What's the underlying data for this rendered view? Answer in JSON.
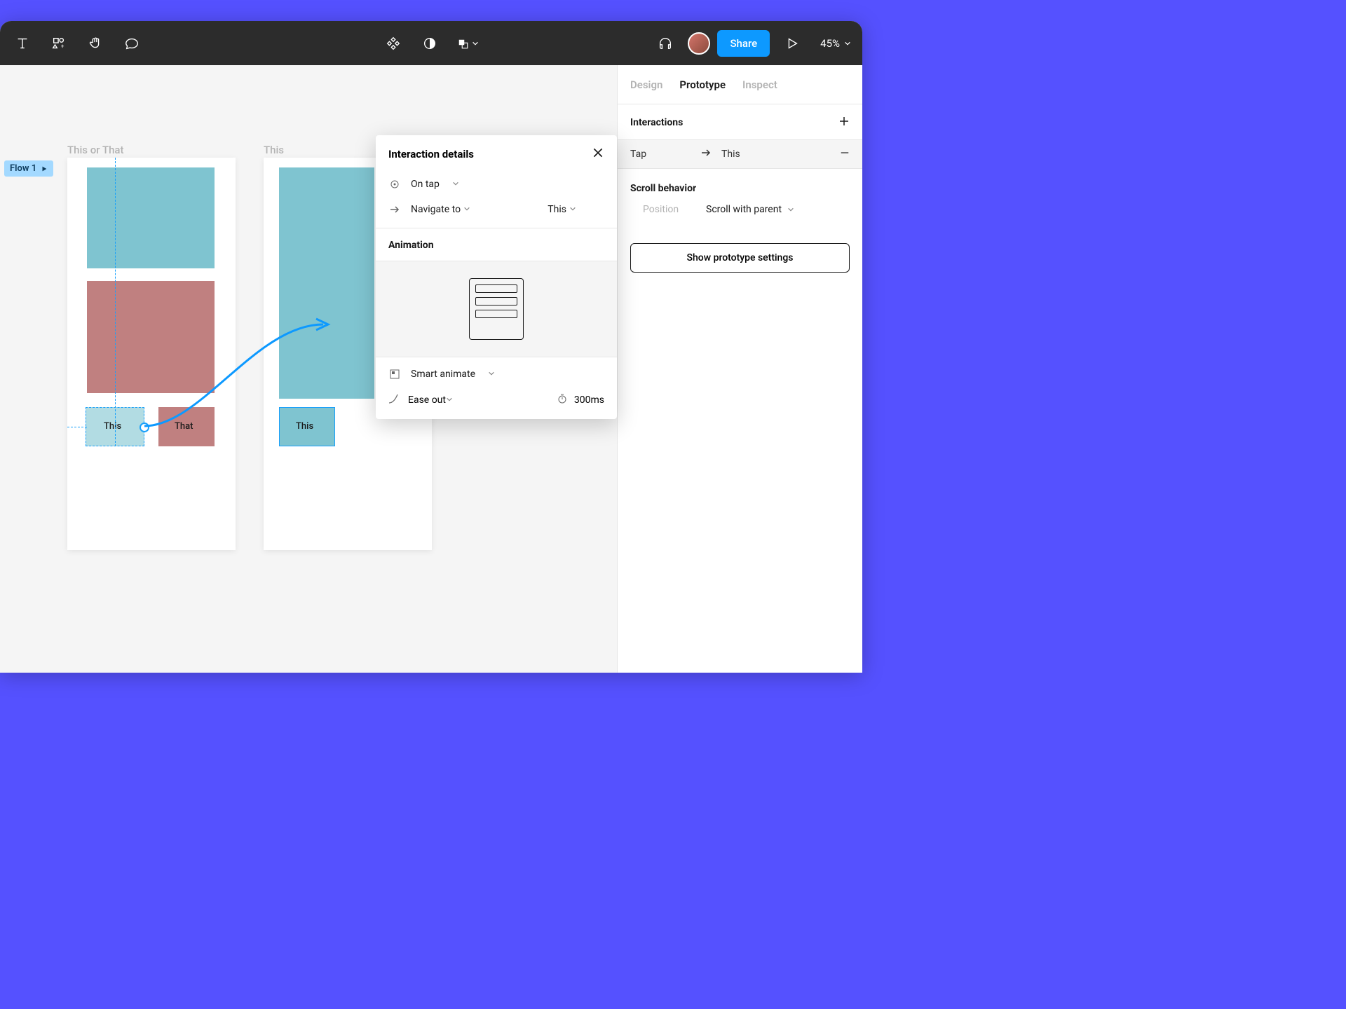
{
  "toolbar": {
    "share_label": "Share",
    "zoom": "45%"
  },
  "panel": {
    "tabs": {
      "design": "Design",
      "prototype": "Prototype",
      "inspect": "Inspect"
    },
    "interactions_title": "Interactions",
    "interaction": {
      "trigger": "Tap",
      "target": "This"
    },
    "scroll_title": "Scroll behavior",
    "scroll_position_label": "Position",
    "scroll_position_value": "Scroll with parent",
    "proto_settings": "Show prototype settings"
  },
  "popup": {
    "title": "Interaction details",
    "trigger": "On tap",
    "action": "Navigate to",
    "destination": "This",
    "animation_title": "Animation",
    "anim_type": "Smart animate",
    "easing": "Ease out",
    "duration": "300ms"
  },
  "canvas": {
    "flow_label": "Flow 1",
    "frame1_label": "This or That",
    "frame2_label": "This",
    "card_this": "This",
    "card_that": "That",
    "card_this2": "This"
  }
}
